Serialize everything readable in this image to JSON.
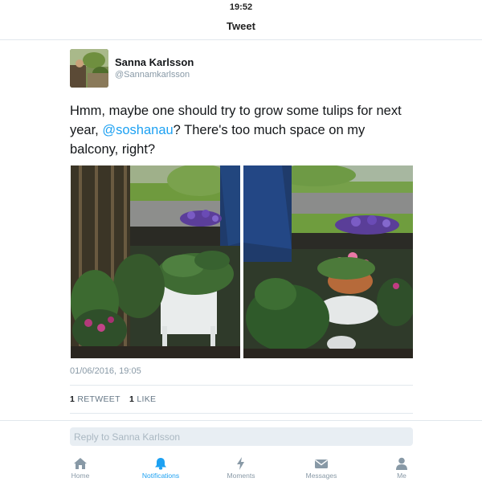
{
  "status_bar": {
    "time": "19:52"
  },
  "nav": {
    "title": "Tweet"
  },
  "author": {
    "name": "Sanna Karlsson",
    "handle": "@Sannamkarlsson"
  },
  "tweet": {
    "text_before": "Hmm, maybe one should try to grow some tulips for next year, ",
    "mention": "@soshanau",
    "text_after": "? There's too much space on my balcony, right?",
    "timestamp": "01/06/2016, 19:05",
    "retweets": {
      "count": "1",
      "label": "RETWEET"
    },
    "likes": {
      "count": "1",
      "label": "LIKE"
    }
  },
  "reply": {
    "placeholder": "Reply to Sanna Karlsson"
  },
  "tabs": [
    {
      "label": "Home",
      "icon": "home-icon",
      "active": false
    },
    {
      "label": "Notifications",
      "icon": "bell-icon",
      "active": true
    },
    {
      "label": "Moments",
      "icon": "lightning-icon",
      "active": false
    },
    {
      "label": "Messages",
      "icon": "envelope-icon",
      "active": false
    },
    {
      "label": "Me",
      "icon": "person-icon",
      "active": false
    }
  ],
  "colors": {
    "accent": "#1da1f2",
    "muted": "#8899a6",
    "text": "#14171a",
    "divider": "#e1e8ed"
  }
}
